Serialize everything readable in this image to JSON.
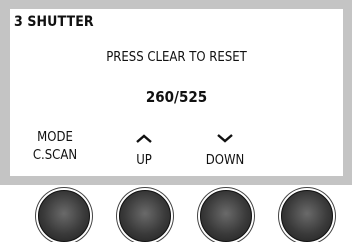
{
  "screen": {
    "title": "3 SHUTTER",
    "message": "PRESS CLEAR TO RESET",
    "counter": "260/525"
  },
  "softkeys": [
    {
      "line1": "MODE",
      "line2": "C.SCAN"
    },
    {
      "icon": "chevron-up-icon",
      "label": "UP"
    },
    {
      "icon": "chevron-down-icon",
      "label": "DOWN"
    }
  ],
  "colors": {
    "bezel": "#c4c4c4",
    "screen": "#ffffff",
    "button": "#3a3a3a"
  }
}
